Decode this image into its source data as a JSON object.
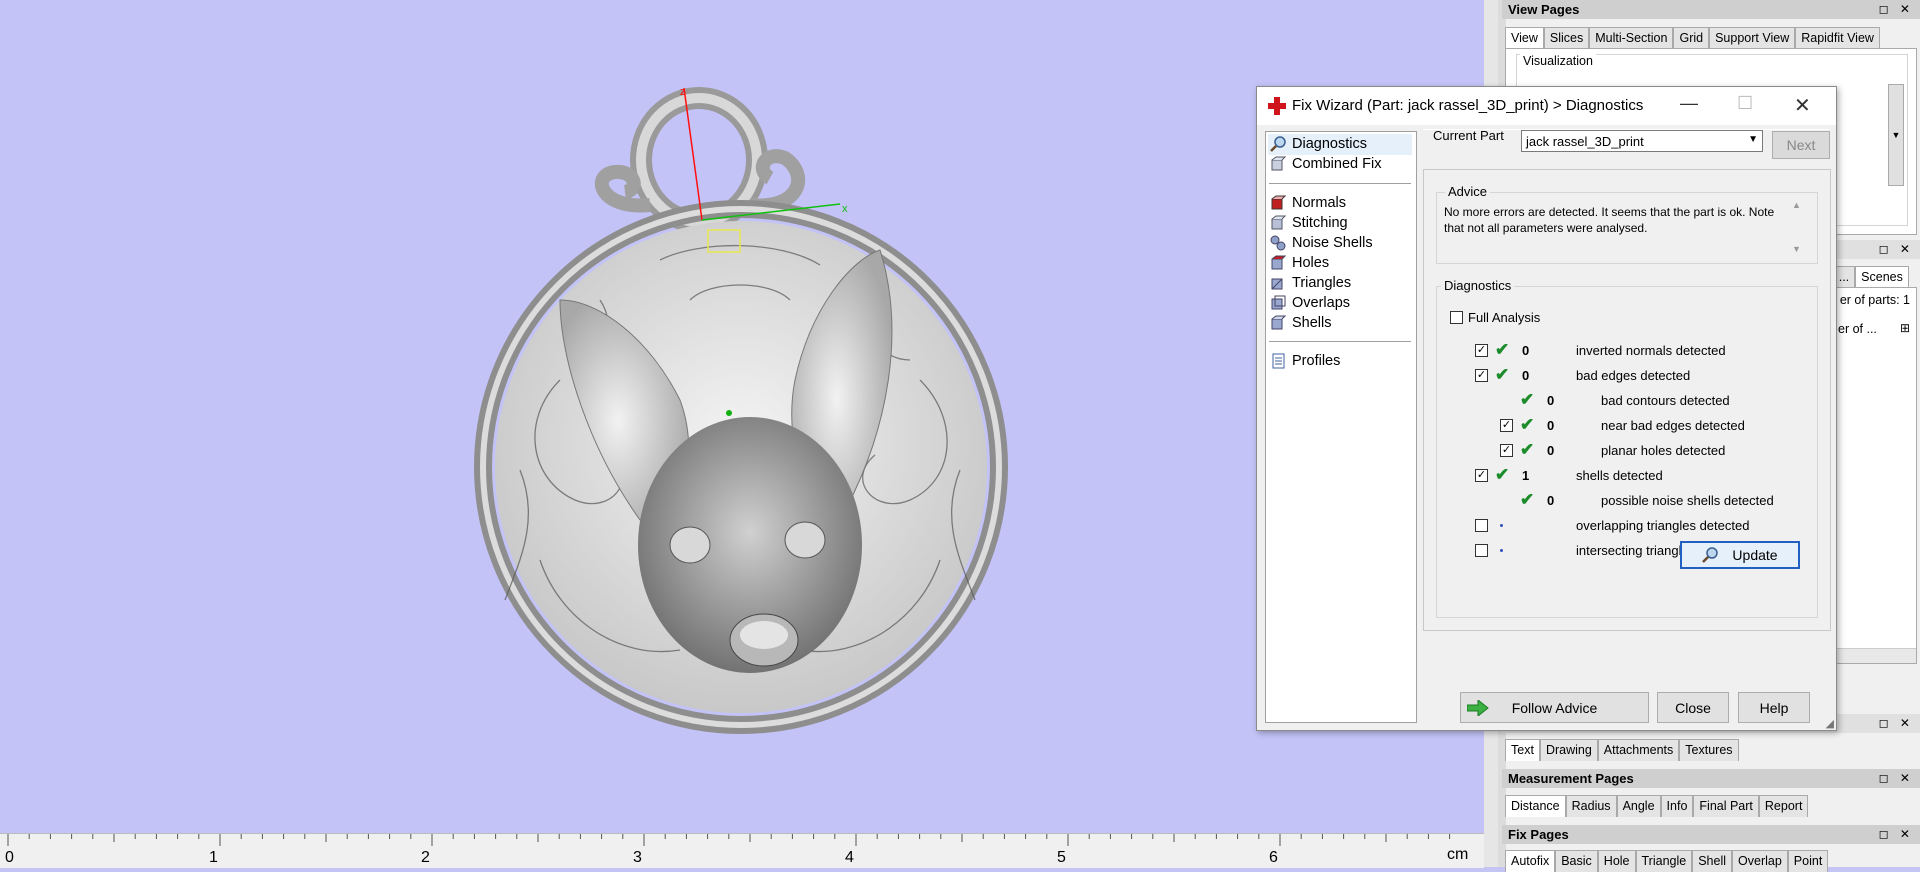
{
  "ruler": {
    "labels": [
      "0",
      "1",
      "2",
      "3",
      "4",
      "5",
      "6"
    ],
    "unit": "cm"
  },
  "axes": {
    "z": "z",
    "x": "x"
  },
  "view_pages": {
    "title": "View Pages",
    "tabs": [
      "View",
      "Slices",
      "Multi-Section",
      "Grid",
      "Support View",
      "Rapidfit View"
    ],
    "visualization_label": "Visualization"
  },
  "parts_panel": {
    "tabs_fragment": "s ...",
    "scenes_tab": "Scenes",
    "count_label": "er of parts: 1",
    "column_fragment": "er of ..."
  },
  "info_panel": {
    "tabs": [
      "Text",
      "Drawing",
      "Attachments",
      "Textures"
    ]
  },
  "measurement_pages": {
    "title": "Measurement Pages",
    "tabs": [
      "Distance",
      "Radius",
      "Angle",
      "Info",
      "Final Part",
      "Report"
    ]
  },
  "fix_pages": {
    "title": "Fix Pages",
    "tabs": [
      "Autofix",
      "Basic",
      "Hole",
      "Triangle",
      "Shell",
      "Overlap",
      "Point"
    ]
  },
  "dialog": {
    "title": "Fix Wizard (Part: jack rassel_3D_print) > Diagnostics",
    "nav_top": [
      "Diagnostics",
      "Combined Fix"
    ],
    "nav_middle": [
      "Normals",
      "Stitching",
      "Noise Shells",
      "Holes",
      "Triangles",
      "Overlaps",
      "Shells"
    ],
    "nav_bottom": [
      "Profiles"
    ],
    "current_part_label": "Current Part",
    "current_part_value": "jack rassel_3D_print",
    "next_button": "Next",
    "advice_label": "Advice",
    "advice_text": "No more errors are detected. It seems that the part is ok. Note that not all parameters were analysed.",
    "diagnostics_label": "Diagnostics",
    "full_analysis_label": "Full Analysis",
    "rows": [
      {
        "checkbox": true,
        "checked": true,
        "status": "ok",
        "count": "0",
        "label": "inverted normals detected",
        "indent": 0
      },
      {
        "checkbox": true,
        "checked": true,
        "status": "ok",
        "count": "0",
        "label": "bad edges detected",
        "indent": 0
      },
      {
        "checkbox": false,
        "checked": false,
        "status": "ok",
        "count": "0",
        "label": "bad contours detected",
        "indent": 1
      },
      {
        "checkbox": true,
        "checked": true,
        "status": "ok",
        "count": "0",
        "label": "near bad edges detected",
        "indent": 1
      },
      {
        "checkbox": true,
        "checked": true,
        "status": "ok",
        "count": "0",
        "label": "planar holes detected",
        "indent": 1
      },
      {
        "checkbox": true,
        "checked": true,
        "status": "ok",
        "count": "1",
        "label": "shells detected",
        "indent": 0
      },
      {
        "checkbox": false,
        "checked": false,
        "status": "ok",
        "count": "0",
        "label": "possible noise shells detected",
        "indent": 1
      },
      {
        "checkbox": true,
        "checked": false,
        "status": "none",
        "count": "",
        "label": "overlapping triangles detected",
        "indent": 0
      },
      {
        "checkbox": true,
        "checked": false,
        "status": "none",
        "count": "",
        "label": "intersecting triangles detected",
        "indent": 0
      }
    ],
    "update_button": "Update",
    "follow_advice_button": "Follow Advice",
    "close_button": "Close",
    "help_button": "Help"
  },
  "colors": {
    "viewport_bg": "#c3c3f7",
    "ok_check": "#1c8c2a",
    "follow_arrow": "#3cb043"
  }
}
